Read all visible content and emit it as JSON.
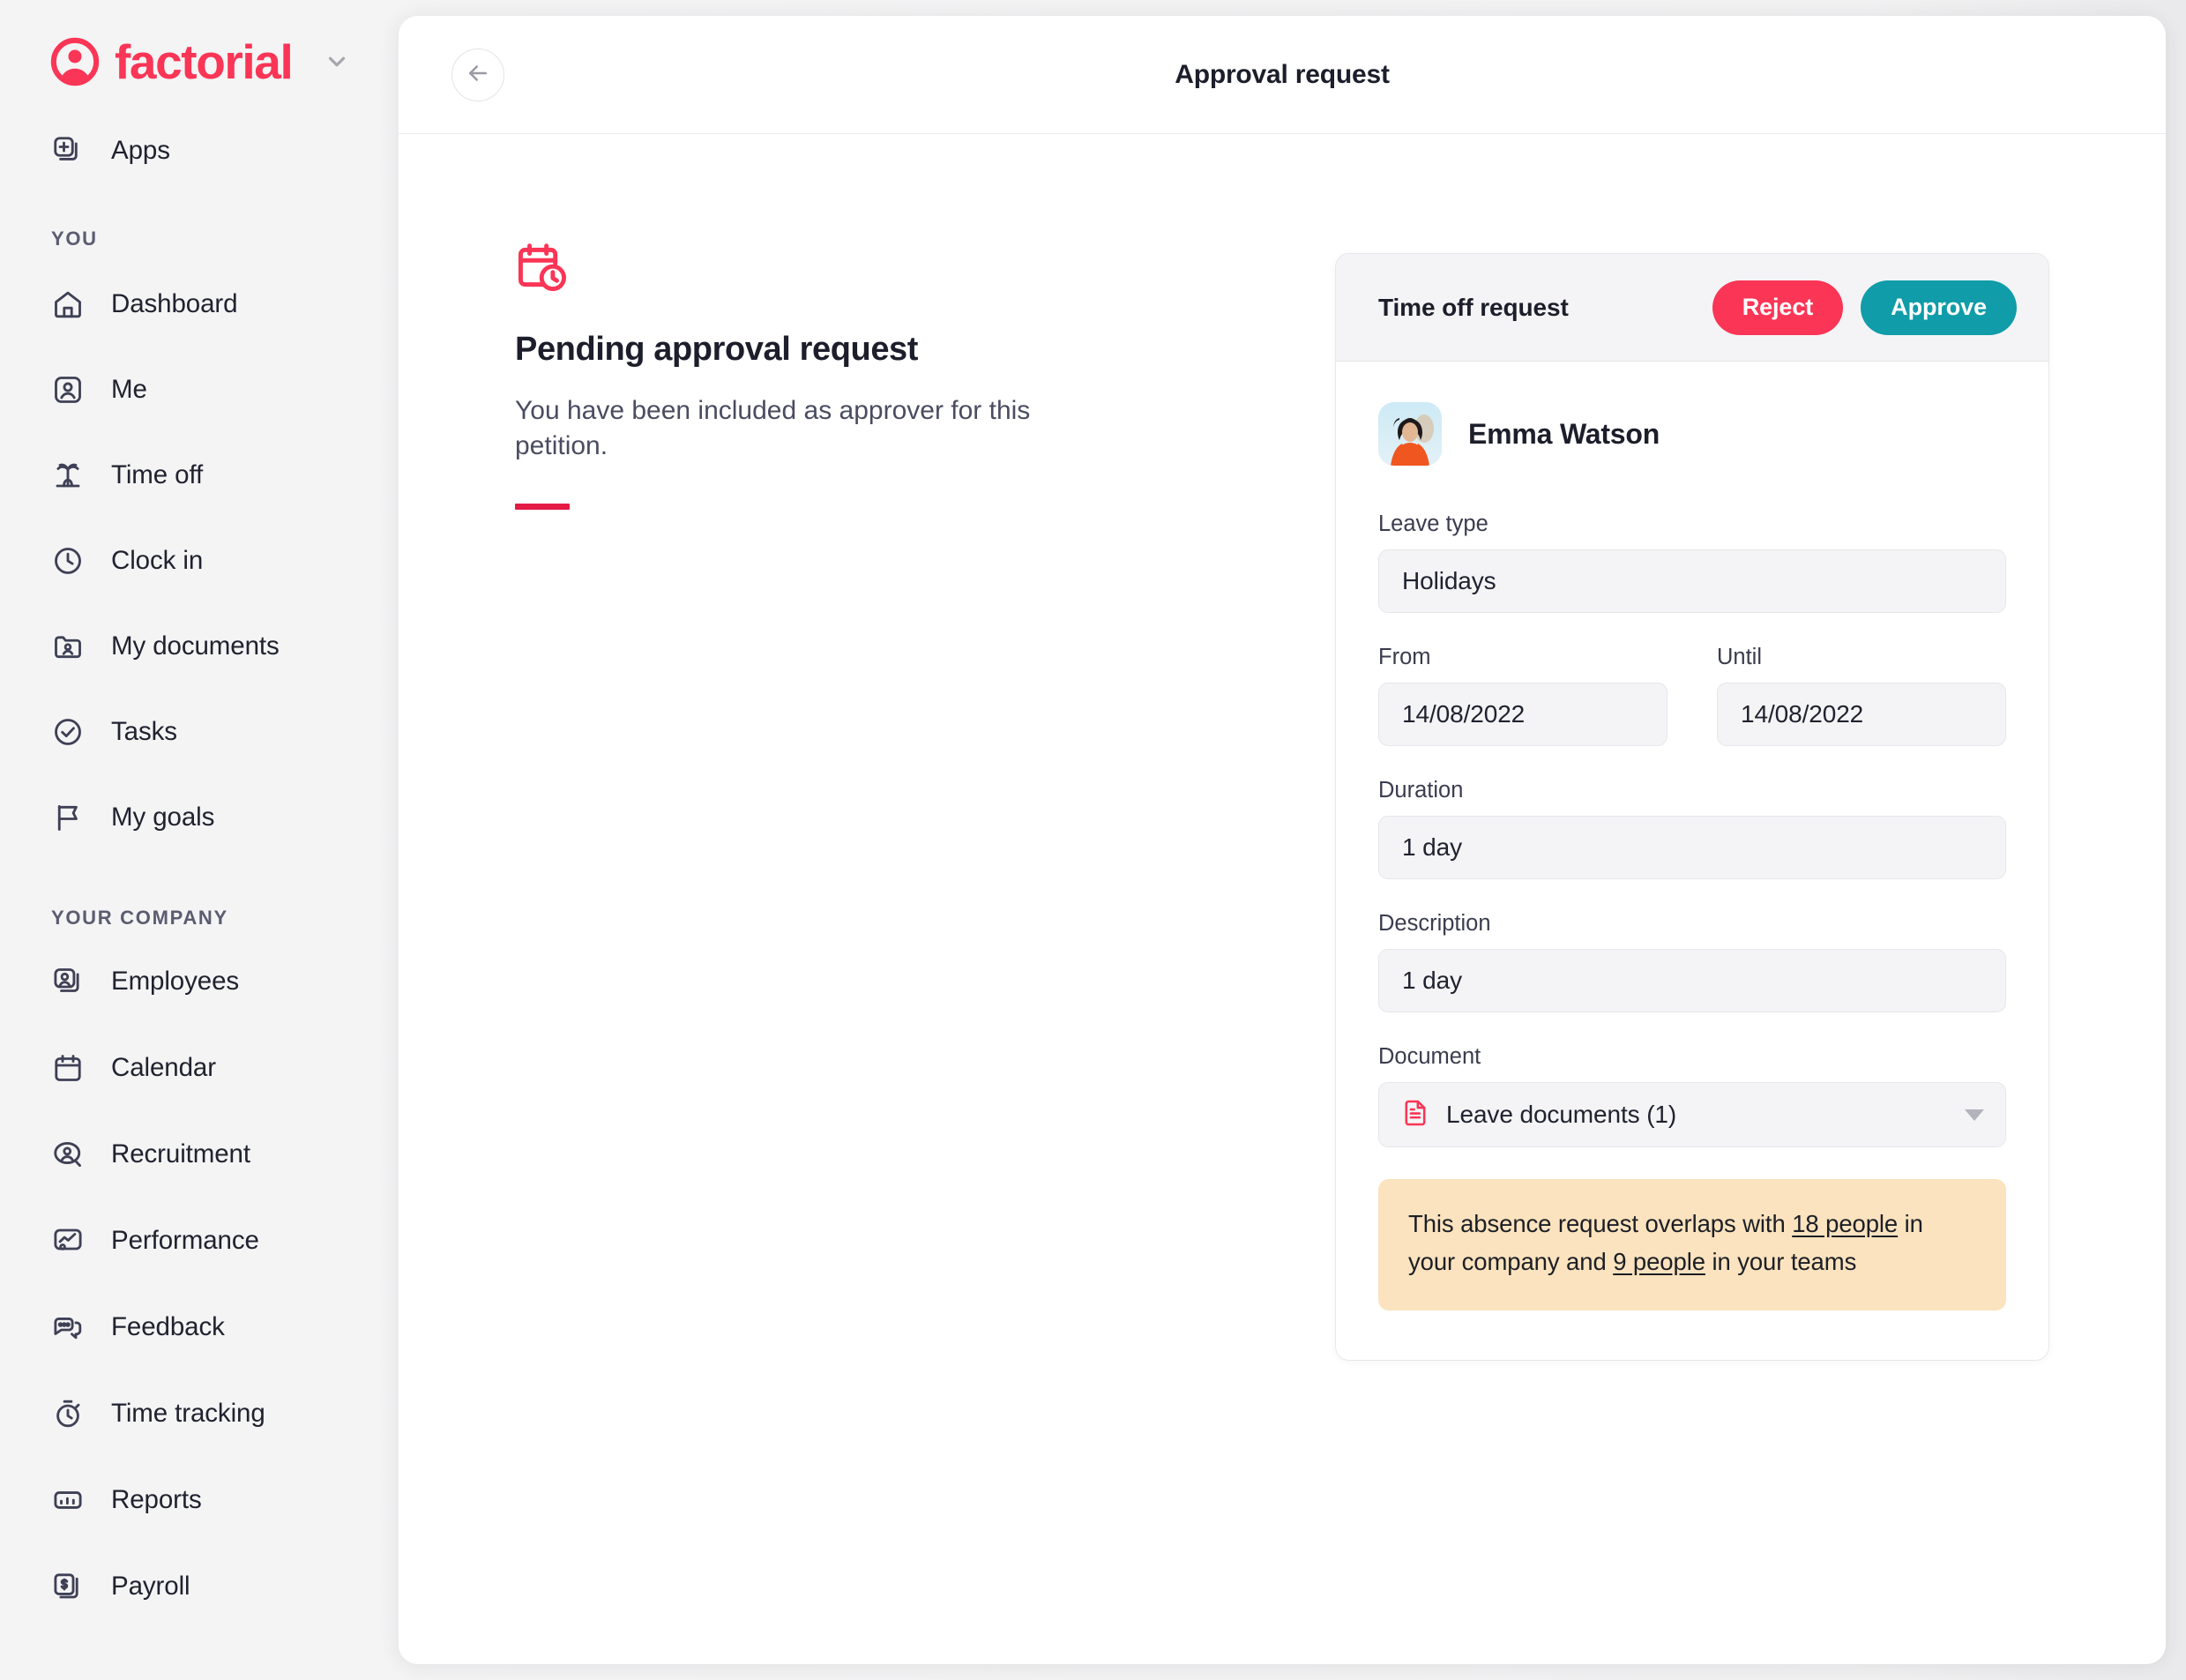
{
  "brand": {
    "name": "factorial",
    "logo_icon": "factorial-logo-icon",
    "caret_icon": "chevron-down-icon",
    "accent_color": "#FA3556"
  },
  "sidebar": {
    "apps": {
      "label": "Apps",
      "icon": "apps-plus-icon"
    },
    "sections": [
      {
        "title": "YOU",
        "items": [
          {
            "label": "Dashboard",
            "icon": "home-icon"
          },
          {
            "label": "Me",
            "icon": "person-card-icon"
          },
          {
            "label": "Time off",
            "icon": "palm-tree-icon"
          },
          {
            "label": "Clock in",
            "icon": "clock-icon"
          },
          {
            "label": "My documents",
            "icon": "folder-person-icon"
          },
          {
            "label": "Tasks",
            "icon": "check-circle-icon"
          },
          {
            "label": "My goals",
            "icon": "flag-icon"
          }
        ]
      },
      {
        "title": "YOUR COMPANY",
        "items": [
          {
            "label": "Employees",
            "icon": "people-stack-icon"
          },
          {
            "label": "Calendar",
            "icon": "calendar-icon"
          },
          {
            "label": "Recruitment",
            "icon": "person-search-icon"
          },
          {
            "label": "Performance",
            "icon": "performance-chart-icon"
          },
          {
            "label": "Feedback",
            "icon": "chat-bubbles-icon"
          },
          {
            "label": "Time tracking",
            "icon": "stopwatch-icon"
          },
          {
            "label": "Reports",
            "icon": "bar-chart-icon"
          },
          {
            "label": "Payroll",
            "icon": "money-bill-icon"
          }
        ]
      }
    ]
  },
  "header": {
    "title": "Approval request",
    "back_icon": "arrow-left-icon"
  },
  "info": {
    "icon": "calendar-clock-icon",
    "title": "Pending approval request",
    "subtitle": "You have been included as approver for this petition.",
    "accent_color": "#E31B45"
  },
  "request_card": {
    "title": "Time off request",
    "reject_label": "Reject",
    "approve_label": "Approve",
    "reject_color": "#FA3556",
    "approve_color": "#109CA9",
    "employee": {
      "name": "Emma Watson",
      "avatar": "employee-photo-avatar"
    },
    "fields": [
      {
        "label": "Leave type",
        "value": "Holidays"
      },
      {
        "label": "From",
        "value": "14/08/2022"
      },
      {
        "label": "Until",
        "value": "14/08/2022"
      },
      {
        "label": "Duration",
        "value": "1 day"
      },
      {
        "label": "Description",
        "value": "1 day"
      }
    ],
    "document": {
      "label": "Document",
      "value": "Leave documents (1)",
      "icon": "document-red-icon",
      "caret_icon": "caret-down-icon"
    },
    "alert": {
      "text_1": "This absence request overlaps with ",
      "link_1": "18 people",
      "text_2": " in your company and ",
      "link_2": "9 people",
      "text_3": " in your teams",
      "background": "#FAE3BE"
    }
  }
}
